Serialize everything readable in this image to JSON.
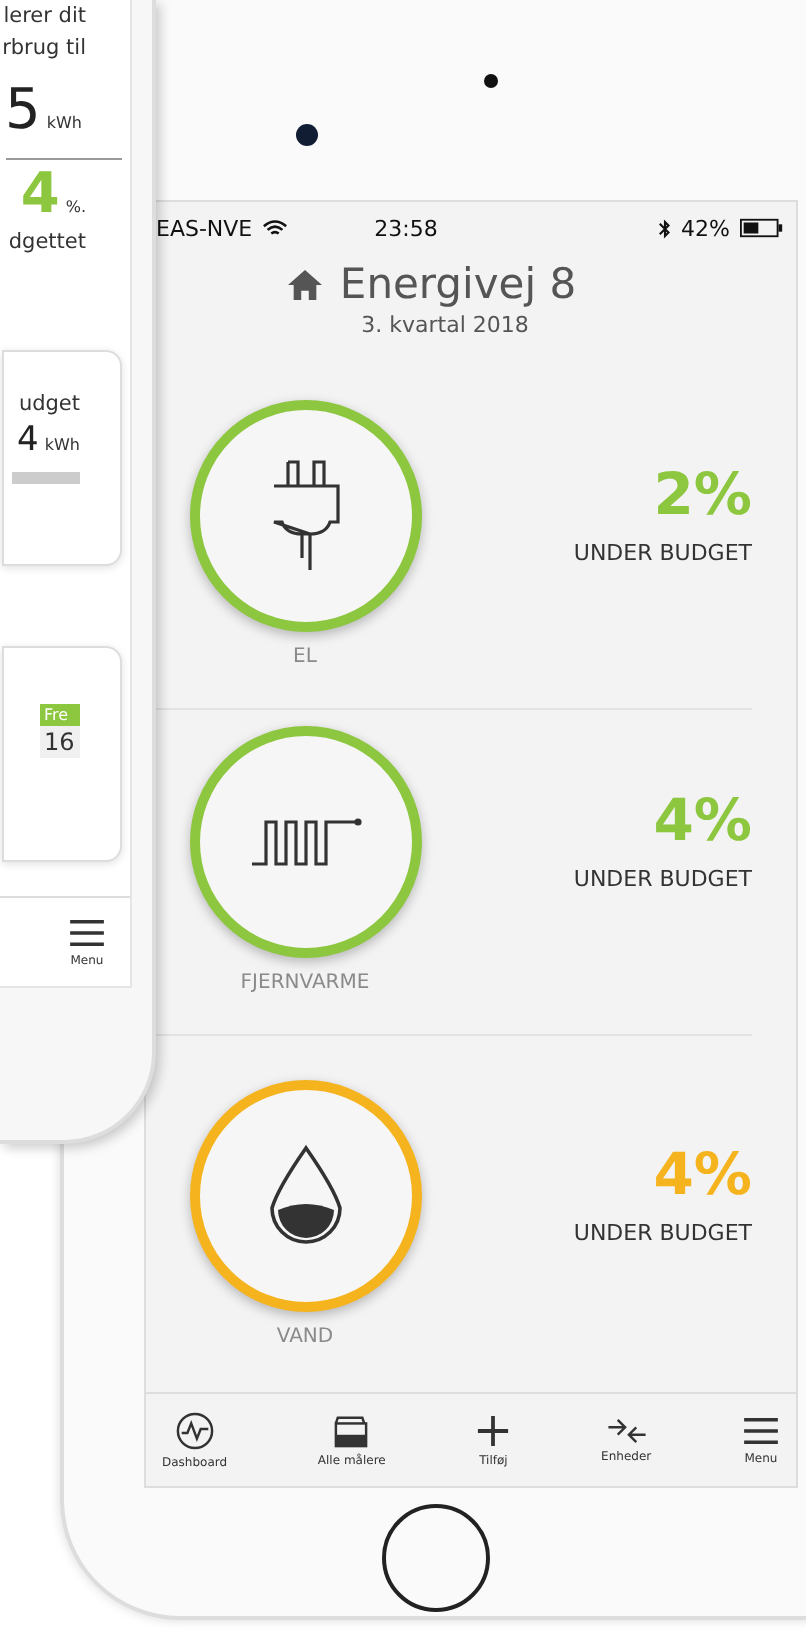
{
  "back_phone": {
    "lines": [
      "lerer dit",
      "rbrug til"
    ],
    "usage_value": "5",
    "usage_unit": "kWh",
    "percent_value": "4",
    "percent_unit": "%.",
    "percent_caption": "dgettet",
    "budget_card": {
      "label": "udget",
      "value": "4",
      "unit": "kWh",
      "level": 1
    },
    "day_card": {
      "day": "Fre",
      "date": "16"
    },
    "nav_label": "Menu"
  },
  "status_bar": {
    "carrier": "EAS-NVE",
    "time": "23:58",
    "battery": "42%"
  },
  "header": {
    "title": "Energivej 8",
    "subtitle": "3. kvartal 2018"
  },
  "meters": [
    {
      "kind": "plug",
      "label": "EL",
      "percent": "2%",
      "caption": "UNDER BUDGET",
      "color": "#8dc63f"
    },
    {
      "kind": "heating",
      "label": "FJERNVARME",
      "percent": "4%",
      "caption": "UNDER BUDGET",
      "color": "#8dc63f"
    },
    {
      "kind": "water",
      "label": "VAND",
      "percent": "4%",
      "caption": "UNDER BUDGET",
      "color": "#f5b41e"
    }
  ],
  "nav": [
    {
      "kind": "dashboard",
      "label": "Dashboard"
    },
    {
      "kind": "meters",
      "label": "Alle målere"
    },
    {
      "kind": "add",
      "label": "Tilføj"
    },
    {
      "kind": "devices",
      "label": "Enheder"
    },
    {
      "kind": "menu",
      "label": "Menu"
    }
  ]
}
